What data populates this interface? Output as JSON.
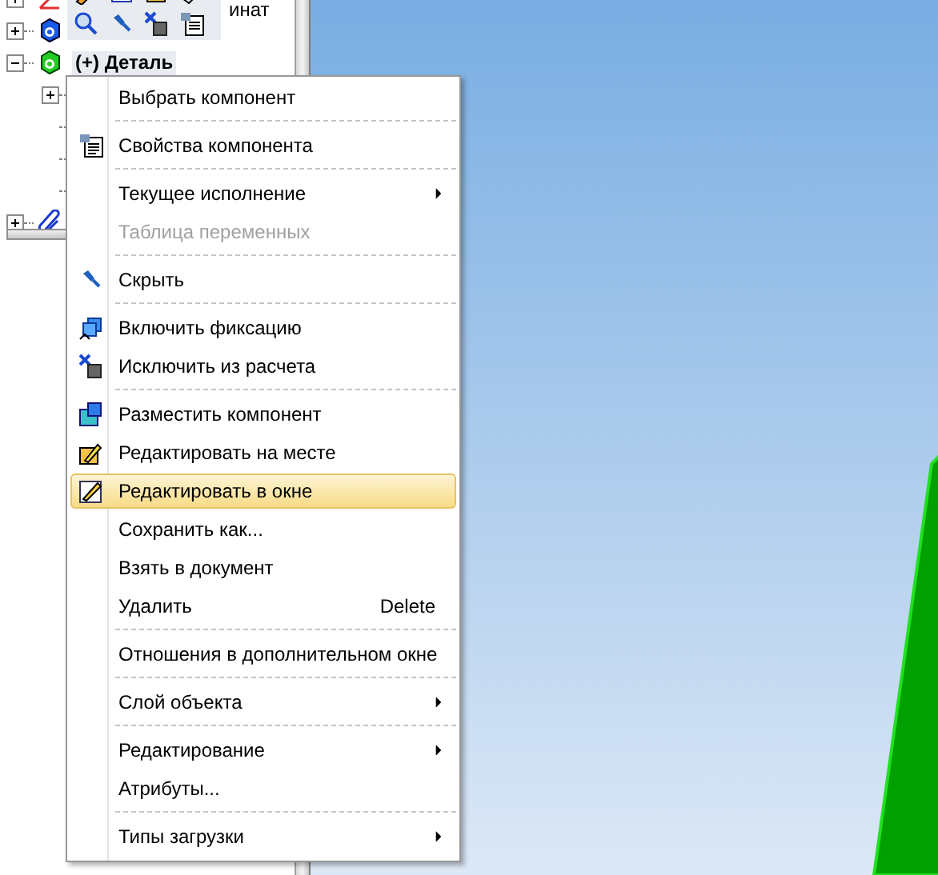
{
  "tree": {
    "items": [
      {
        "kind": "node",
        "label": "инат",
        "expanded": false
      },
      {
        "kind": "node",
        "expanded": false
      },
      {
        "kind": "node",
        "label": "(+) Деталь",
        "expanded": true,
        "children": [
          {
            "kind": "node",
            "expanded": false
          },
          {
            "kind": "leaf"
          },
          {
            "kind": "leaf"
          },
          {
            "kind": "leaf"
          }
        ]
      },
      {
        "kind": "node",
        "expanded": false
      }
    ]
  },
  "context_menu": {
    "items": [
      {
        "kind": "item",
        "label": "Выбрать компонент",
        "disabled": false,
        "selected": false
      },
      {
        "kind": "separator"
      },
      {
        "kind": "item",
        "label": "Свойства компонента",
        "disabled": false,
        "selected": false
      },
      {
        "kind": "separator"
      },
      {
        "kind": "item",
        "label": "Текущее исполнение",
        "disabled": false,
        "selected": false,
        "submenu": true
      },
      {
        "kind": "item",
        "label": "Таблица переменных",
        "disabled": true,
        "selected": false
      },
      {
        "kind": "separator"
      },
      {
        "kind": "item",
        "label": "Скрыть",
        "disabled": false,
        "selected": false
      },
      {
        "kind": "separator"
      },
      {
        "kind": "item",
        "label": "Включить фиксацию",
        "disabled": false,
        "selected": false
      },
      {
        "kind": "item",
        "label": "Исключить из расчета",
        "disabled": false,
        "selected": false
      },
      {
        "kind": "separator"
      },
      {
        "kind": "item",
        "label": "Разместить компонент",
        "disabled": false,
        "selected": false
      },
      {
        "kind": "item",
        "label": "Редактировать на месте",
        "disabled": false,
        "selected": false
      },
      {
        "kind": "item",
        "label": "Редактировать в окне",
        "disabled": false,
        "selected": true
      },
      {
        "kind": "item",
        "label": "Сохранить как...",
        "disabled": false,
        "selected": false
      },
      {
        "kind": "item",
        "label": "Взять в документ",
        "disabled": false,
        "selected": false
      },
      {
        "kind": "item",
        "label": "Удалить",
        "shortcut": "Delete",
        "disabled": false,
        "selected": false
      },
      {
        "kind": "separator"
      },
      {
        "kind": "item",
        "label": "Отношения в дополнительном окне",
        "disabled": false,
        "selected": false
      },
      {
        "kind": "separator"
      },
      {
        "kind": "item",
        "label": "Слой объекта",
        "disabled": false,
        "selected": false,
        "submenu": true
      },
      {
        "kind": "separator"
      },
      {
        "kind": "item",
        "label": "Редактирование",
        "disabled": false,
        "selected": false,
        "submenu": true
      },
      {
        "kind": "item",
        "label": "Атрибуты...",
        "disabled": false,
        "selected": false
      },
      {
        "kind": "separator"
      },
      {
        "kind": "item",
        "label": "Типы загрузки",
        "disabled": false,
        "selected": false,
        "submenu": true
      }
    ]
  }
}
